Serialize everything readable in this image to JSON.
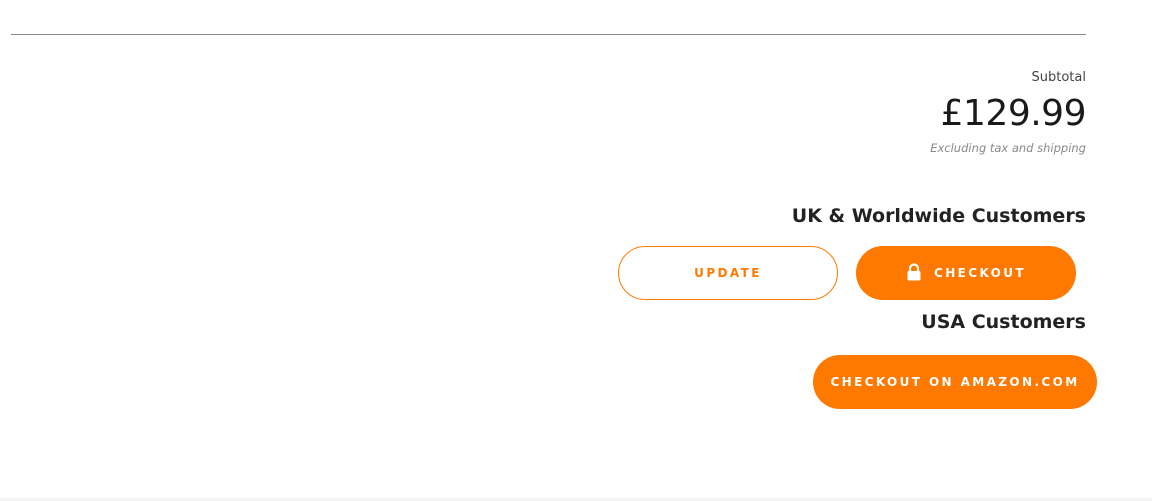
{
  "cart": {
    "subtotal_label": "Subtotal",
    "subtotal_amount": "£129.99",
    "tax_note": "Excluding tax and shipping"
  },
  "uk_section": {
    "heading": "UK & Worldwide Customers",
    "update_label": "UPDATE",
    "checkout_label": "CHECKOUT",
    "checkout_icon": "lock-icon"
  },
  "usa_section": {
    "heading": "USA Customers",
    "amazon_checkout_label": "CHECKOUT ON AMAZON.COM"
  },
  "colors": {
    "accent": "#ff7800",
    "text": "#222222",
    "muted": "#888888",
    "divider": "#8a8a8a"
  }
}
